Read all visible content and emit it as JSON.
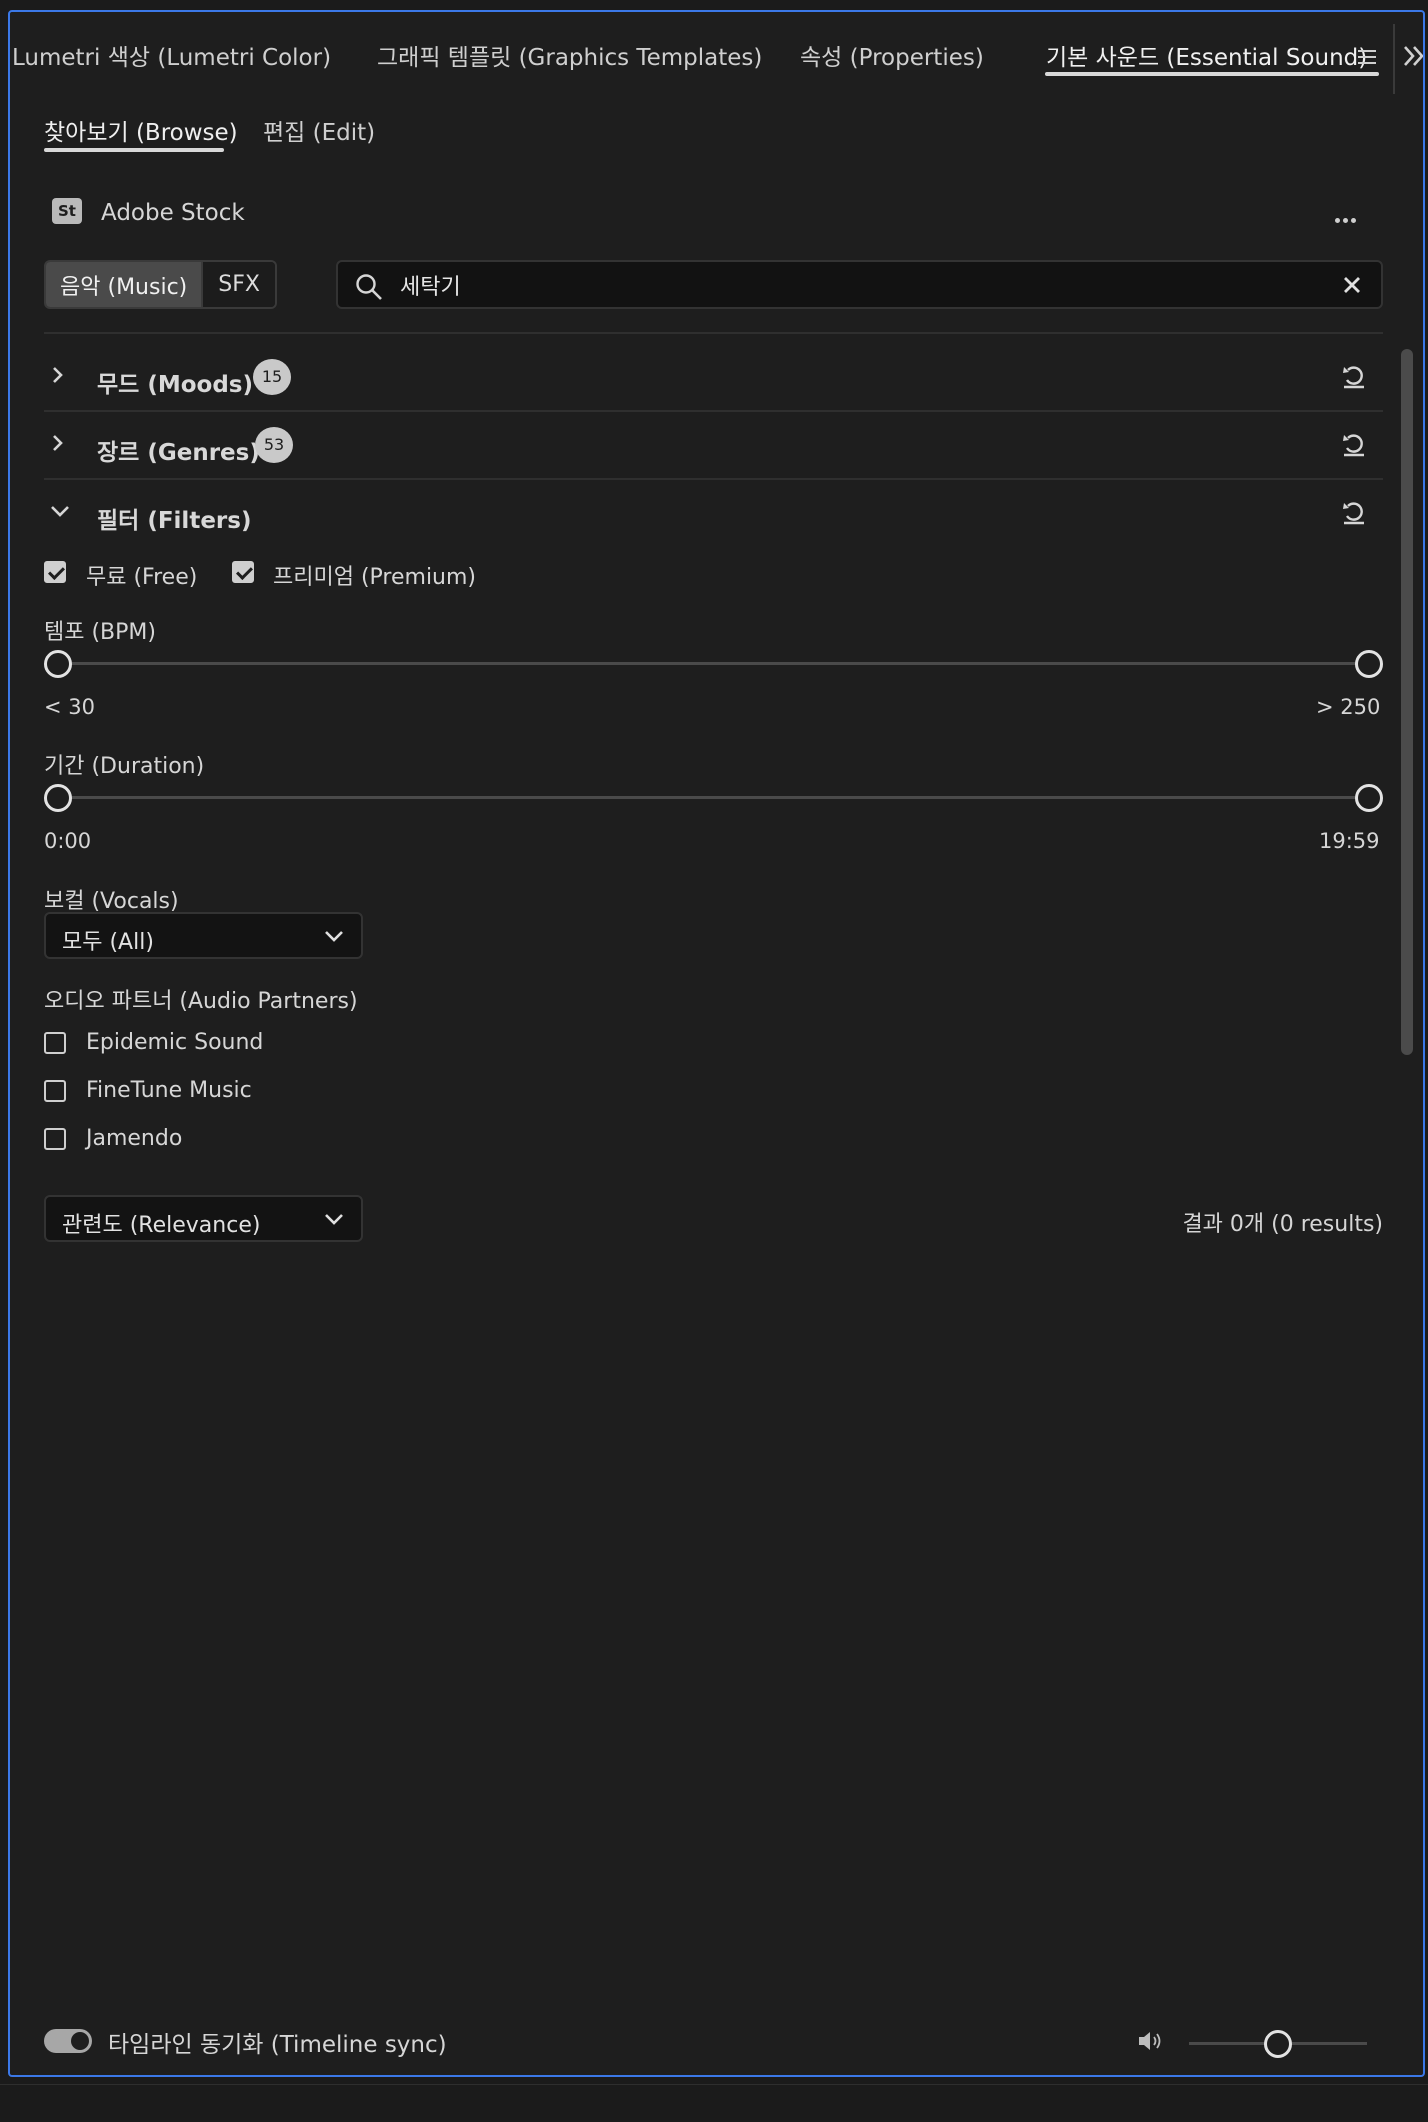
{
  "top_tabs": [
    {
      "label": "Lumetri 색상 (Lumetri Color)"
    },
    {
      "label": "그래픽 템플릿 (Graphics Templates)"
    },
    {
      "label": "속성 (Properties)"
    },
    {
      "label": "기본 사운드 (Essential Sound)"
    }
  ],
  "sub_tabs": [
    {
      "label": "찾아보기 (Browse)"
    },
    {
      "label": "편집 (Edit)"
    }
  ],
  "stock": {
    "logo": "St",
    "label": "Adobe Stock"
  },
  "type_toggle": {
    "music": "음악 (Music)",
    "sfx": "SFX",
    "selected": "음악 (Music)"
  },
  "search": {
    "value": "세탁기"
  },
  "sections": {
    "moods": {
      "title": "무드 (Moods)",
      "count": "15",
      "expanded": false
    },
    "genres": {
      "title": "장르 (Genres)",
      "count": "53",
      "expanded": false
    },
    "filters": {
      "title": "필터 (Filters)",
      "expanded": true
    }
  },
  "filters": {
    "free": {
      "label": "무료 (Free)",
      "checked": true
    },
    "premium": {
      "label": "프리미엄 (Premium)",
      "checked": true
    },
    "tempo": {
      "label": "템포 (BPM)",
      "min_label": "< 30",
      "max_label": "> 250",
      "low": 0,
      "high": 1
    },
    "duration": {
      "label": "기간 (Duration)",
      "min_label": "0:00",
      "max_label": "19:59",
      "low": 0,
      "high": 1
    },
    "vocals": {
      "label": "보컬 (Vocals)",
      "value": "모두 (All)"
    },
    "partners": {
      "label": "오디오 파트너 (Audio Partners)",
      "items": [
        {
          "label": "Epidemic Sound",
          "checked": false
        },
        {
          "label": "FineTune Music",
          "checked": false
        },
        {
          "label": "Jamendo",
          "checked": false
        }
      ]
    }
  },
  "sort": {
    "value": "관련도 (Relevance)"
  },
  "results": {
    "text": "결과 0개 (0 results)"
  },
  "footer": {
    "timeline_sync_label": "타임라인 동기화 (Timeline sync)",
    "timeline_sync_on": true,
    "volume": 0.5
  },
  "colors": {
    "accent_border": "#3b78e7",
    "panel_bg": "#1e1e1e"
  }
}
